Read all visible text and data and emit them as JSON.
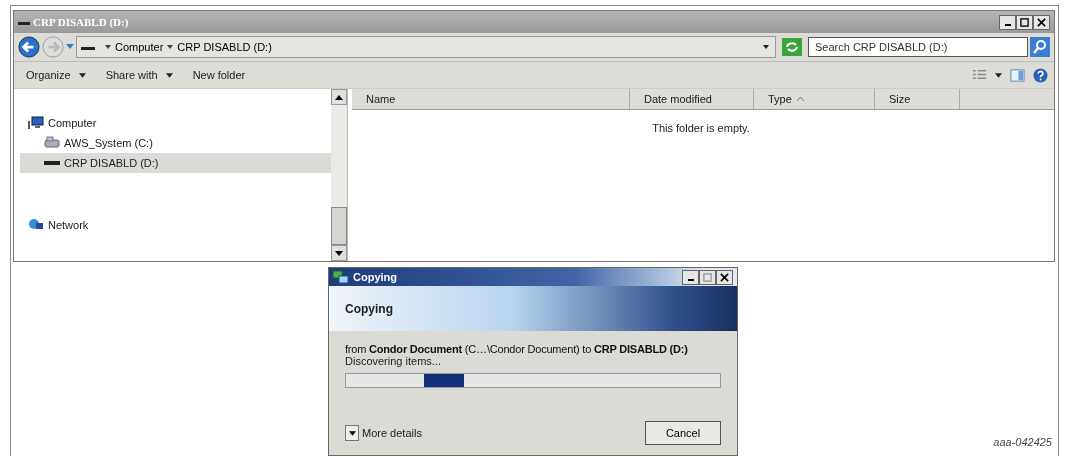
{
  "explorer": {
    "title": "CRP DISABLD (D:)",
    "breadcrumb": [
      "Computer",
      "CRP DISABLD (D:)"
    ],
    "search": {
      "placeholder": "Search CRP DISABLD (D:)"
    },
    "toolbar": [
      {
        "label": "Organize",
        "has_menu": true
      },
      {
        "label": "Share with",
        "has_menu": true
      },
      {
        "label": "New folder",
        "has_menu": false
      }
    ],
    "nav": [
      {
        "label": "Computer",
        "kind": "computer",
        "selected": false,
        "children": [
          {
            "label": "AWS_System (C:)",
            "kind": "drive",
            "selected": false
          },
          {
            "label": "CRP DISABLD (D:)",
            "kind": "removable",
            "selected": true
          }
        ]
      },
      {
        "label": "Network",
        "kind": "network",
        "selected": false
      }
    ],
    "columns": [
      {
        "label": "Name",
        "sorted": false
      },
      {
        "label": "Date modified",
        "sorted": false
      },
      {
        "label": "Type",
        "sorted": true
      },
      {
        "label": "Size",
        "sorted": false
      }
    ],
    "empty_message": "This folder is empty."
  },
  "dialog": {
    "title": "Copying",
    "heading": "Copying",
    "description": "from **Condor Document** (C…\\Condor Document) to **CRP DISABLD (D:)**",
    "status": "Discovering items...",
    "progress": {
      "indeterminate": true
    },
    "details_label": "More details",
    "cancel": "Cancel"
  },
  "figure_label": "aaa-042425"
}
